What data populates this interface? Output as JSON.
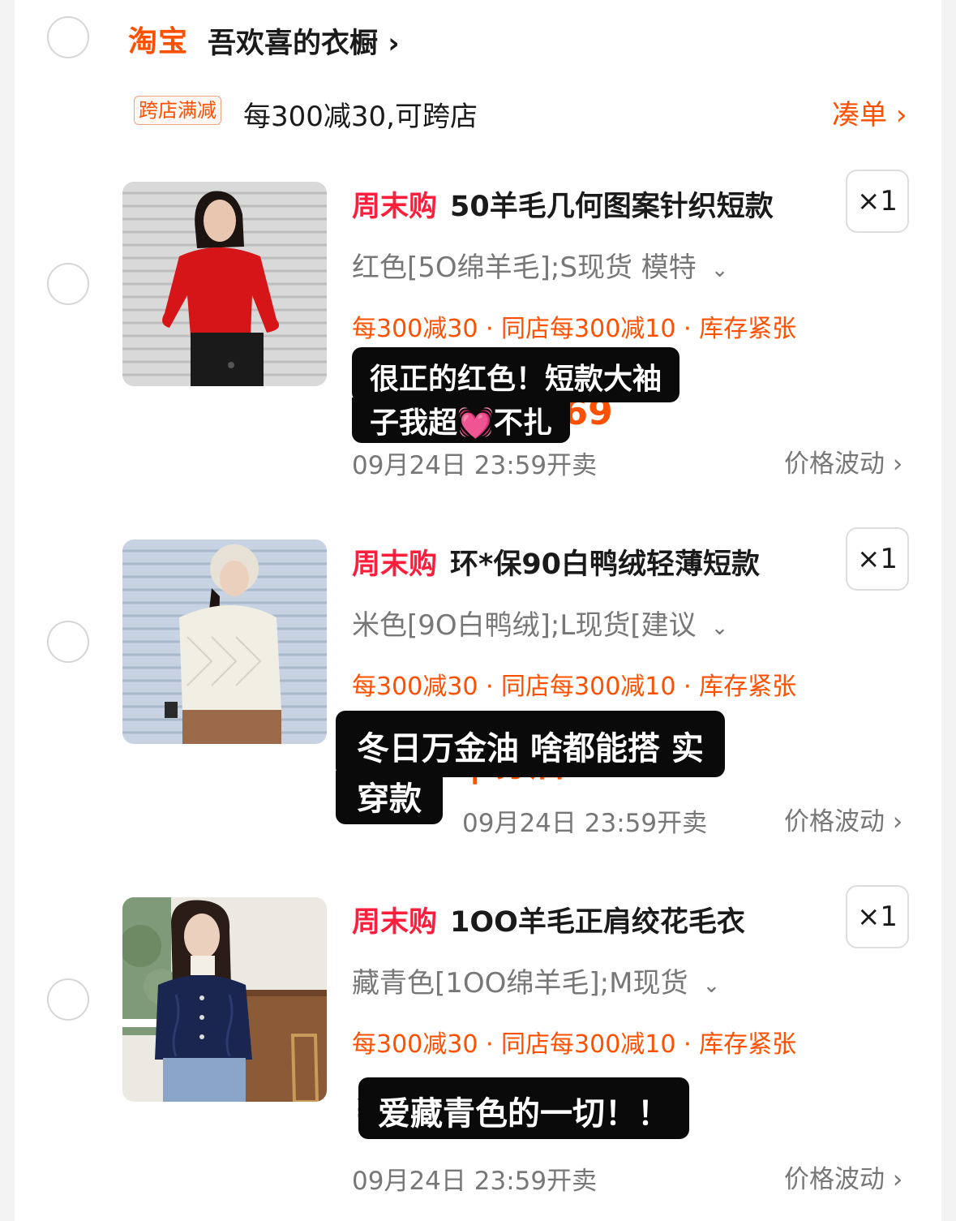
{
  "shop": {
    "logo": "淘宝",
    "name": "吾欢喜的衣橱",
    "chevron": "›",
    "promo_tag": "跨店满减",
    "promo_text": "每300减30,可跨店",
    "cou_label": "凑单",
    "cou_chevron": "›"
  },
  "items": [
    {
      "tag": "周末购",
      "title": "50羊毛几何图案针织短款",
      "qty": "×1",
      "sku": "红色[5O绵羊毛];S现货 模特",
      "sku_arrow": "⌄",
      "promos": "每300减30 · 同店每300减10 · 库存紧张",
      "sale_time": "09月24日 23:59开卖",
      "price_fluct": "价格波动 ›",
      "price_hidden": "¥ 到手价 ¥669",
      "caption_line1": "很正的红色！短款大袖",
      "caption_line2_a": "子我超",
      "caption_heart": "💓",
      "caption_line2_b": "不扎",
      "image": "woman-red-cardigan-photo"
    },
    {
      "tag": "周末购",
      "title": "环*保90白鸭绒轻薄短款",
      "qty": "×1",
      "sku": "米色[9O白鸭绒];L现货[建议",
      "sku_arrow": "⌄",
      "promos": "每300减30 · 同店每300减10 · 库存紧张",
      "sale_time": "09月24日 23:59开卖",
      "price_fluct": "价格波动 ›",
      "price_hidden": "¥777 | 券后¥669",
      "caption_line1": "冬日万金油 啥都能搭 实",
      "caption_line2": "穿款",
      "image": "woman-white-down-jacket-photo"
    },
    {
      "tag": "周末购",
      "title": "1OO羊毛正肩绞花毛衣",
      "qty": "×1",
      "sku": "藏青色[1OO绵羊毛];M现货",
      "sku_arrow": "⌄",
      "promos": "每300减30 · 同店每300减10 · 库存紧张",
      "sale_time": "09月24日 23:59开卖",
      "price_fluct": "价格波动 ›",
      "price_hidden": "¥ 9",
      "caption_line1": "爱藏青色的一切！！",
      "image": "woman-navy-cable-knit-photo"
    }
  ],
  "colors": {
    "brand_orange": "#ff5000",
    "weekend_red": "#ff1f3d",
    "caption_bg": "#0a0a0a"
  }
}
